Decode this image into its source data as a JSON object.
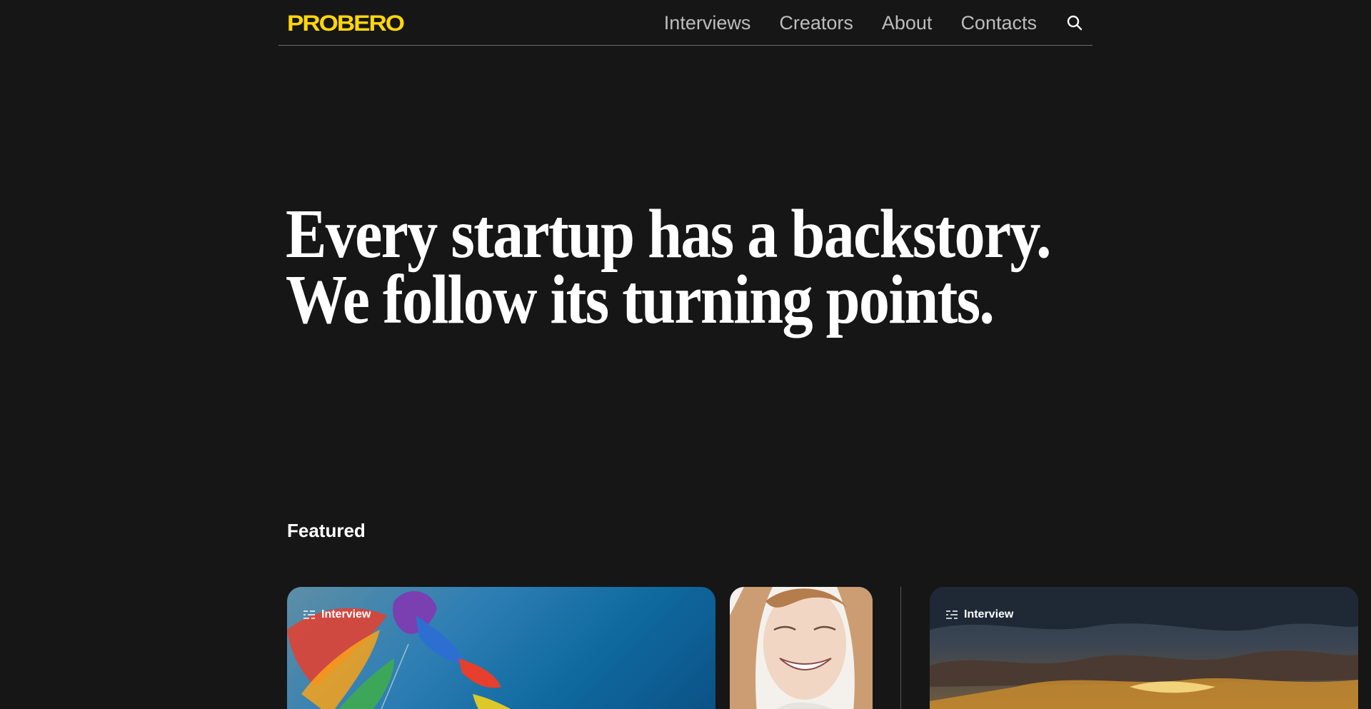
{
  "header": {
    "logo": "PROBERO",
    "nav": [
      "Interviews",
      "Creators",
      "About",
      "Contacts"
    ]
  },
  "hero": {
    "line1": "Every startup has a backstory.",
    "line2": "We follow its turning points."
  },
  "featured": {
    "heading": "Featured",
    "cards": [
      {
        "badge": "Interview",
        "image": "rainbow-bird-kite-illustration"
      },
      {
        "image": "smiling-woman-pencil-portrait"
      },
      {
        "badge": "Interview",
        "image": "stormy-sunset-sky-painting"
      }
    ]
  },
  "colors": {
    "background": "#161616",
    "logo": "#ffd60a",
    "nav_text": "#bdbdbd"
  }
}
